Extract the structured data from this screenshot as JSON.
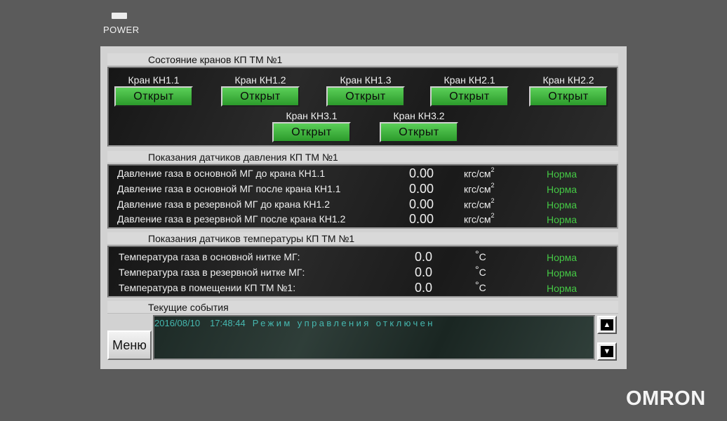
{
  "power_label": "POWER",
  "brand": "OMRON",
  "valves_section": {
    "title": "Состояние кранов КП ТМ №1",
    "valves": [
      {
        "label": "Кран КН1.1",
        "state": "Открыт"
      },
      {
        "label": "Кран КН1.2",
        "state": "Открыт"
      },
      {
        "label": "Кран КН1.3",
        "state": "Открыт"
      },
      {
        "label": "Кран КН2.1",
        "state": "Открыт"
      },
      {
        "label": "Кран КН2.2",
        "state": "Открыт"
      },
      {
        "label": "Кран КН3.1",
        "state": "Открыт"
      },
      {
        "label": "Кран КН3.2",
        "state": "Открыт"
      }
    ]
  },
  "pressure_section": {
    "title": "Показания датчиков давления КП ТМ №1",
    "unit": "кгс/см",
    "unit_sup": "2",
    "rows": [
      {
        "label": "Давление газа в основной МГ до крана КН1.1",
        "value": "0.00",
        "status": "Норма"
      },
      {
        "label": "Давление газа в основной МГ после крана КН1.1",
        "value": "0.00",
        "status": "Норма"
      },
      {
        "label": "Давление газа в резервной МГ до крана КН1.2",
        "value": "0.00",
        "status": "Норма"
      },
      {
        "label": "Давление газа в резервной МГ после крана КН1.2",
        "value": "0.00",
        "status": "Норма"
      }
    ]
  },
  "temperature_section": {
    "title": "Показания датчиков температуры КП ТМ №1",
    "unit_deg": "°",
    "unit": "C",
    "rows": [
      {
        "label": "Температура газа в основной нитке МГ:",
        "value": "0.0",
        "status": "Норма"
      },
      {
        "label": "Температура газа в резервной нитке МГ:",
        "value": "0.0",
        "status": "Норма"
      },
      {
        "label": "Температура в помещении КП ТМ №1:",
        "value": "0.0",
        "status": "Норма"
      }
    ]
  },
  "events_section": {
    "title": "Текущие события",
    "events": [
      {
        "date": "2016/08/10",
        "time": "17:48:44",
        "message": "Режим управления отключен"
      }
    ],
    "menu_label": "Меню",
    "scroll_up_icon": "▲",
    "scroll_down_icon": "▼"
  },
  "colors": {
    "valve_open": "#3cb83a",
    "status_ok": "#45c845",
    "event_text": "#46b8b0"
  }
}
